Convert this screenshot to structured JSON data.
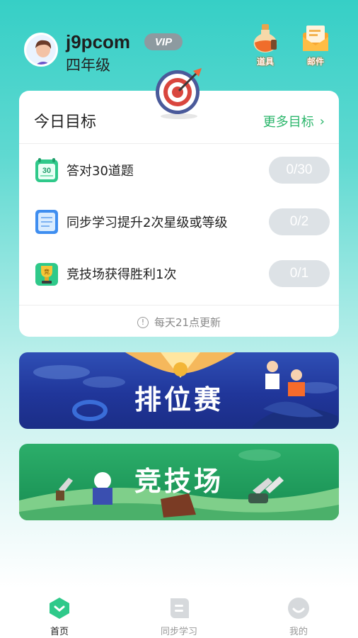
{
  "profile": {
    "username": "j9pcom",
    "grade": "四年级",
    "vip_label": "VIP"
  },
  "toolbar": {
    "props_label": "道具",
    "mail_label": "邮件"
  },
  "goals": {
    "title": "今日目标",
    "more_label": "更多目标",
    "items": [
      {
        "text": "答对30道题",
        "progress": "0/30",
        "icon": "calendar-30-icon"
      },
      {
        "text": "同步学习提升2次星级或等级",
        "progress": "0/2",
        "icon": "notebook-icon"
      },
      {
        "text": "竞技场获得胜利1次",
        "progress": "0/1",
        "icon": "trophy-icon"
      }
    ],
    "refresh_note": "每天21点更新"
  },
  "banners": {
    "rank_title": "排位赛",
    "arena_title": "竞技场"
  },
  "nav": {
    "home": "首页",
    "sync": "同步学习",
    "mine": "我的"
  },
  "colors": {
    "accent_green": "#2bb66b",
    "progress_pill": "#dde2e6",
    "rank_banner": "#20369a",
    "arena_banner": "#1f9a5b"
  }
}
